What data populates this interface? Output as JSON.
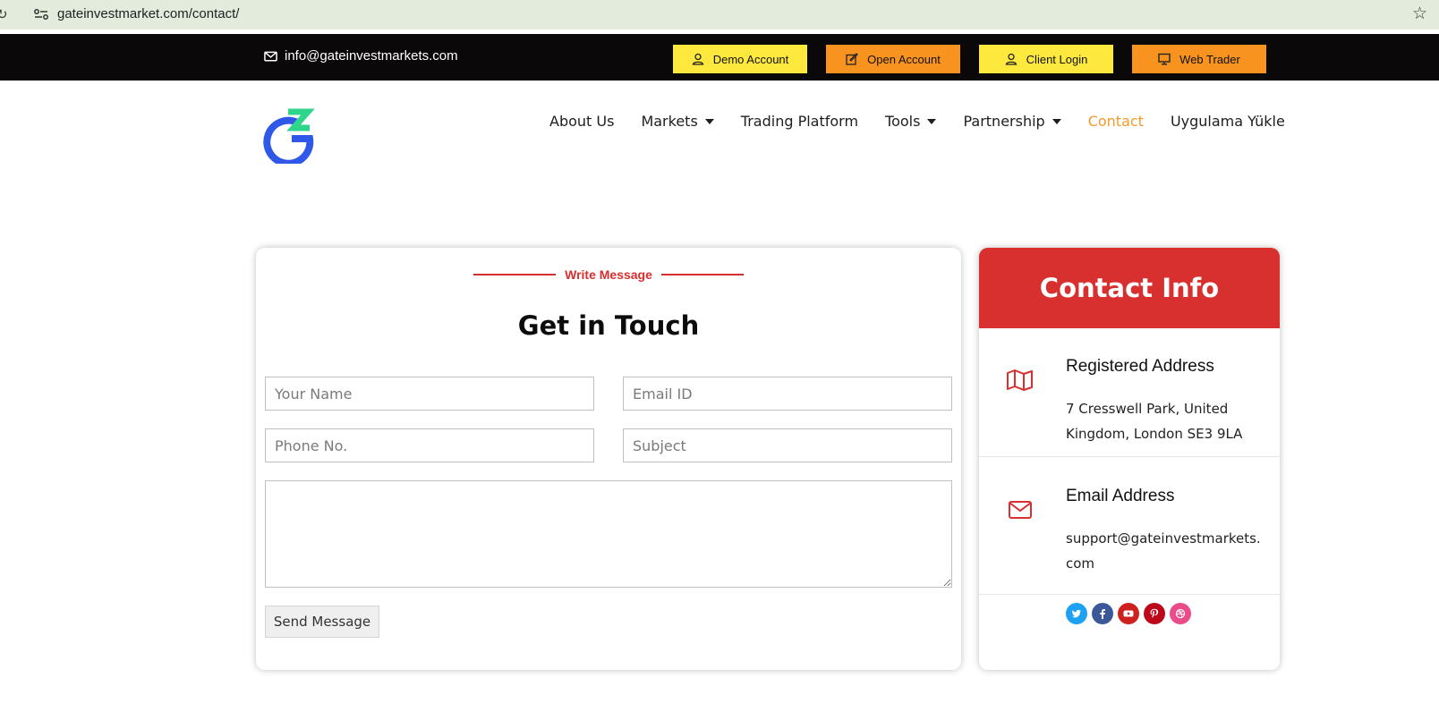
{
  "browser": {
    "url": "gateinvestmarket.com/contact/"
  },
  "top_strip": {
    "email": "info@gateinvestmarkets.com",
    "buttons": [
      {
        "label": "Demo Account",
        "color": "#fde93e",
        "icon": "user-icon"
      },
      {
        "label": "Open Account",
        "color": "#f7931e",
        "icon": "edit-icon"
      },
      {
        "label": "Client Login",
        "color": "#fde93e",
        "icon": "user-icon"
      },
      {
        "label": "Web Trader",
        "color": "#f7931e",
        "icon": "monitor-icon"
      }
    ]
  },
  "nav": {
    "items": [
      {
        "label": "About Us",
        "dropdown": false
      },
      {
        "label": "Markets",
        "dropdown": true
      },
      {
        "label": "Trading Platform",
        "dropdown": false
      },
      {
        "label": "Tools",
        "dropdown": true
      },
      {
        "label": "Partnership",
        "dropdown": true
      },
      {
        "label": "Contact",
        "dropdown": false,
        "active": true
      },
      {
        "label": "Uygulama Yükle",
        "dropdown": false
      }
    ],
    "active_color": "#f39a2c"
  },
  "form": {
    "eyebrow": "Write Message",
    "title": "Get in Touch",
    "name_placeholder": "Your Name",
    "email_placeholder": "Email ID",
    "phone_placeholder": "Phone No.",
    "subject_placeholder": "Subject",
    "submit_label": "Send Message"
  },
  "contact_info": {
    "title": "Contact Info",
    "header_color": "#d82f2f",
    "address_title": "Registered Address",
    "address": "7 Cresswell Park, United Kingdom, London SE3 9LA",
    "email_title": "Email Address",
    "email": "support@gateinvestmarkets.com",
    "socials": [
      {
        "name": "twitter-icon",
        "color": "#1da1f2"
      },
      {
        "name": "facebook-icon",
        "color": "#3b5998"
      },
      {
        "name": "youtube-icon",
        "color": "#cd201f"
      },
      {
        "name": "pinterest-icon",
        "color": "#bd081c"
      },
      {
        "name": "dribbble-icon",
        "color": "#ea4c89"
      }
    ]
  }
}
